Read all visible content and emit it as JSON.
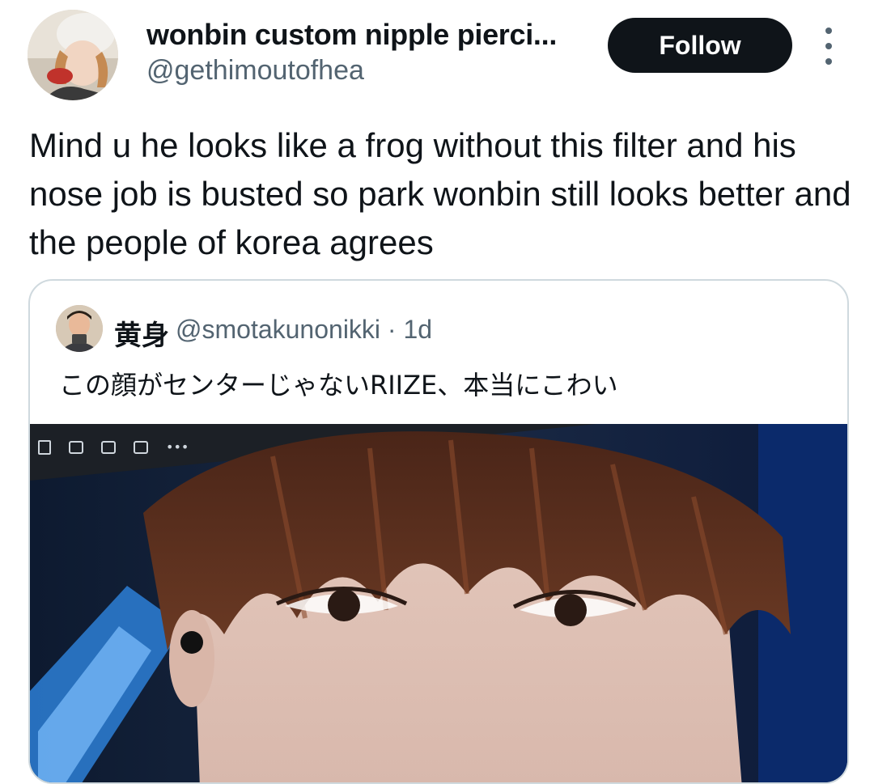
{
  "author": {
    "display_name": "wonbin custom nipple pierci...",
    "handle": "@gethimoutofhea",
    "avatar_icon": "profile-photo"
  },
  "actions": {
    "follow_label": "Follow",
    "more_icon": "more-vertical-icon"
  },
  "tweet": {
    "text": "Mind u he looks like a frog without this filter and his nose job is busted so park wonbin still looks better and the people of korea agrees"
  },
  "quoted": {
    "display_name": "黄身",
    "handle_time": "@smotakunonikki · 1d",
    "text": "この顔がセンターじゃないRIIZE、本当にこわい",
    "media_toolbar_icons": [
      "trash-icon",
      "print-icon",
      "share-icon",
      "play-icon",
      "more-horizontal-icon"
    ]
  },
  "colors": {
    "text_primary": "#0f1419",
    "text_secondary": "#536471",
    "border": "#cfd9de",
    "button_bg": "#0f1419"
  }
}
